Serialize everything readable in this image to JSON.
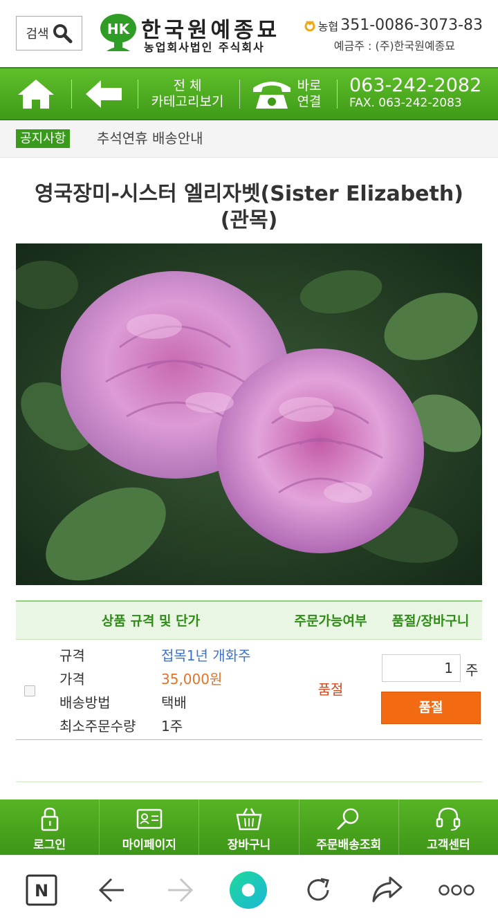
{
  "header": {
    "search_label": "검색",
    "logo_mark_text": "HK",
    "logo_title": "한국원예종묘",
    "logo_subtitle": "농업회사법인 주식회사",
    "bank_name": "농협",
    "account_number": "351-0086-3073-83",
    "account_holder": "예금주 : (주)한국원예종묘"
  },
  "navbar": {
    "category_line1": "전 체",
    "category_line2": "카테고리보기",
    "direct_line1": "바로",
    "direct_line2": "연결",
    "phone": "063-242-2082",
    "fax": "FAX. 063-242-2083"
  },
  "notice": {
    "badge": "공지사항",
    "text": "추석연휴 배송안내"
  },
  "product": {
    "title": "영국장미-시스터 엘리자벳(Sister Elizabeth)(관목)",
    "image_icon": "rose-photo"
  },
  "table": {
    "headers": [
      "상품 규격 및 단가",
      "주문가능여부",
      "품절/장바구니"
    ],
    "specs": [
      {
        "label": "규격",
        "value": "접목1년 개화주"
      },
      {
        "label": "가격",
        "value": "35,000원"
      },
      {
        "label": "배송방법",
        "value": "택배"
      },
      {
        "label": "최소주문수량",
        "value": "1주"
      }
    ],
    "availability": "품절",
    "quantity": "1",
    "quantity_unit": "주",
    "soldout_button": "품절"
  },
  "bottom_menu": {
    "items": [
      {
        "label": "로그인",
        "icon": "lock-icon"
      },
      {
        "label": "마이페이지",
        "icon": "id-card-icon"
      },
      {
        "label": "장바구니",
        "icon": "basket-icon"
      },
      {
        "label": "주문배송조회",
        "icon": "search-icon"
      },
      {
        "label": "고객센터",
        "icon": "headset-icon"
      }
    ]
  },
  "browser_bar": {
    "home_letter": "N",
    "icons": [
      "naver-home-icon",
      "back-arrow-icon",
      "forward-arrow-icon",
      "green-dot-icon",
      "refresh-icon",
      "share-icon",
      "more-icon"
    ]
  },
  "colors": {
    "brand_green": "#3f9b18",
    "accent_orange": "#f26b12",
    "soldout_red": "#cf4a1e"
  }
}
